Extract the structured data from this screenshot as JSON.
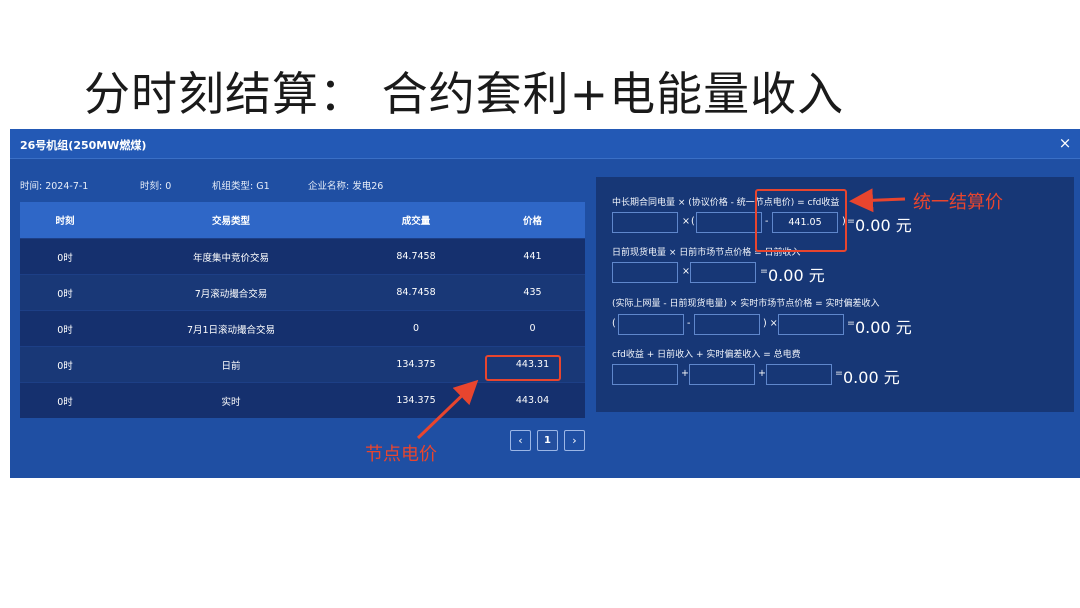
{
  "slide": {
    "title": "分时刻结算：  合约套利+电能量收入"
  },
  "dialog": {
    "title": "26号机组(250MW燃煤)",
    "close_icon": "×"
  },
  "meta": {
    "time": "时间: 2024-7-1",
    "moment": "时刻: 0",
    "unit_type": "机组类型: G1",
    "company": "企业名称: 发电26"
  },
  "table": {
    "headers": [
      "时刻",
      "交易类型",
      "成交量",
      "价格"
    ],
    "rows": [
      [
        "0时",
        "年度集中竞价交易",
        "84.7458",
        "441"
      ],
      [
        "0时",
        "7月滚动撮合交易",
        "84.7458",
        "435"
      ],
      [
        "0时",
        "7月1日滚动撮合交易",
        "0",
        "0"
      ],
      [
        "0时",
        "日前",
        "134.375",
        "443.31"
      ],
      [
        "0时",
        "实时",
        "134.375",
        "443.04"
      ]
    ]
  },
  "pagination": {
    "prev_icon": "‹",
    "page": "1",
    "next_icon": "›"
  },
  "calc": {
    "f1": "中长期合同电量 × (协议价格 - 统一节点电价) = cfd收益",
    "f1_value": "441.05",
    "f1_result": "0.00 元",
    "f2": "日前现货电量 × 日前市场节点价格 = 日前收入",
    "f2_result": "0.00 元",
    "f3": "(实际上网量 - 日前现货电量) × 实时市场节点价格 = 实时偏差收入",
    "f3_result": "0.00 元",
    "f4": "cfd收益 + 日前收入 + 实时偏差收入 = 总电费",
    "f4_result": "0.00 元",
    "ops": {
      "times": "×",
      "lparen": "(",
      "minus": "-",
      "rparen": ")",
      "equals": "=",
      "plus": "+",
      "rparen_times": ") ×"
    }
  },
  "annotations": {
    "unified_price": "统一结算价",
    "node_price": "节点电价",
    "color": "#e8452e"
  }
}
